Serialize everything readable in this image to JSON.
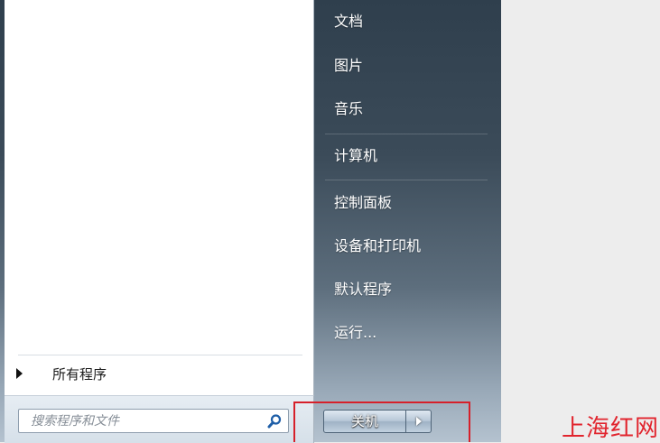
{
  "right_menu": {
    "items": [
      {
        "label": "文档"
      },
      {
        "label": "图片"
      },
      {
        "label": "音乐"
      },
      {
        "label": "计算机"
      },
      {
        "label": "控制面板"
      },
      {
        "label": "设备和打印机"
      },
      {
        "label": "默认程序"
      },
      {
        "label": "运行..."
      }
    ]
  },
  "left_menu": {
    "all_programs_label": "所有程序"
  },
  "search": {
    "placeholder": "搜索程序和文件",
    "icon": "search-icon"
  },
  "shutdown": {
    "label": "关机",
    "arrow_icon": "triangle-right-icon"
  },
  "watermark": {
    "text": "上海红网"
  },
  "colors": {
    "highlight": "#d6202a",
    "watermark": "#e1252e"
  }
}
